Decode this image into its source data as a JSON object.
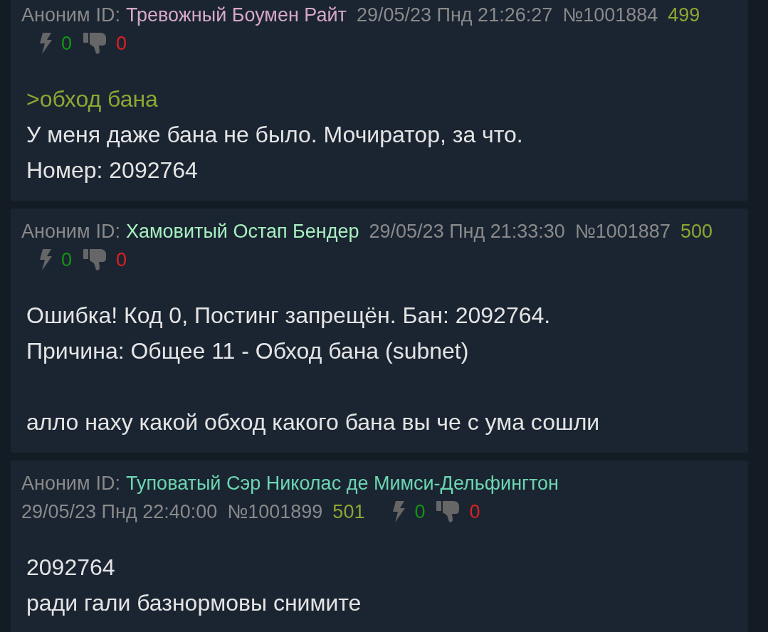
{
  "posts": [
    {
      "author": "Аноним",
      "id_label": "ID:",
      "id_name": "Тревожный Боумен Райт",
      "color": "#d7a8c8",
      "date": "29/05/23 Пнд 21:26:27",
      "number": "№1001884",
      "ordinal": "499",
      "likes": "0",
      "dislikes": "0",
      "paragraphs": [
        [
          {
            "kind": "quote",
            "text": ">обход бана"
          },
          {
            "kind": "text",
            "text": "У меня даже бана не было. Мочиратор, за что."
          },
          {
            "kind": "text",
            "text": "Номер: 2092764"
          }
        ]
      ]
    },
    {
      "author": "Аноним",
      "id_label": "ID:",
      "id_name": "Хамовитый Остап Бендер",
      "color": "#a8f0c0",
      "date": "29/05/23 Пнд 21:33:30",
      "number": "№1001887",
      "ordinal": "500",
      "likes": "0",
      "dislikes": "0",
      "paragraphs": [
        [
          {
            "kind": "text",
            "text": "Ошибка! Код 0, Постинг запрещён. Бан: 2092764."
          },
          {
            "kind": "text",
            "text": "Причина: Общее 11 - Обход бана (subnet)"
          }
        ],
        [
          {
            "kind": "text",
            "text": "алло наху какой обход какого бана вы че с ума сошли"
          }
        ]
      ]
    },
    {
      "author": "Аноним",
      "id_label": "ID:",
      "id_name": "Туповатый Сэр Николас де Мимси-Дельфингтон",
      "color": "#6cd6b0",
      "date": "29/05/23 Пнд 22:40:00",
      "number": "№1001899",
      "ordinal": "501",
      "likes": "0",
      "dislikes": "0",
      "paragraphs": [
        [
          {
            "kind": "text",
            "text": "2092764"
          },
          {
            "kind": "text",
            "text": "ради гали базнормовы снимите"
          }
        ]
      ]
    }
  ]
}
